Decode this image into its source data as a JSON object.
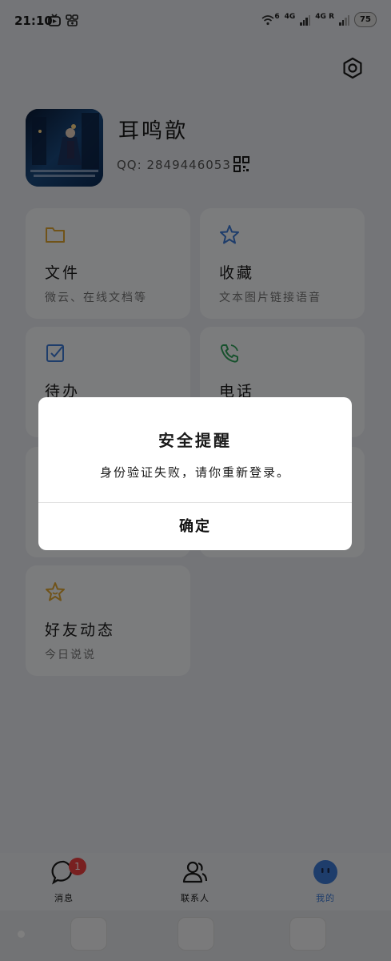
{
  "status_bar": {
    "time": "21:10",
    "network1": "4G",
    "network2": "4G R",
    "wifi_label": "6",
    "battery": "75"
  },
  "profile": {
    "nickname": "耳鸣歆",
    "qq_label": "QQ:",
    "qq_number": "2849446053"
  },
  "cards": [
    {
      "title": "文件",
      "subtitle": "微云、在线文档等",
      "icon": "folder-icon",
      "color": "#e0a632"
    },
    {
      "title": "收藏",
      "subtitle": "文本图片链接语音",
      "icon": "star-icon",
      "color": "#3d7ad6"
    },
    {
      "title": "待办",
      "subtitle": "",
      "icon": "checkbox-icon",
      "color": "#3d7ad6"
    },
    {
      "title": "电话",
      "subtitle": "",
      "icon": "phone-icon",
      "color": "#2fa35a"
    },
    {
      "title": "好友动态",
      "subtitle": "今日说说",
      "icon": "star-face-icon",
      "color": "#e0a632"
    }
  ],
  "bottom_nav": {
    "messages": {
      "label": "消息",
      "badge": "1"
    },
    "contacts": {
      "label": "联系人"
    },
    "me": {
      "label": "我的"
    }
  },
  "dialog": {
    "title": "安全提醒",
    "message": "身份验证失败，请你重新登录。",
    "confirm": "确定"
  },
  "colors": {
    "accent": "#3d7ad6",
    "badge": "#f04040",
    "overlay": "rgba(0,0,0,0.5)"
  }
}
